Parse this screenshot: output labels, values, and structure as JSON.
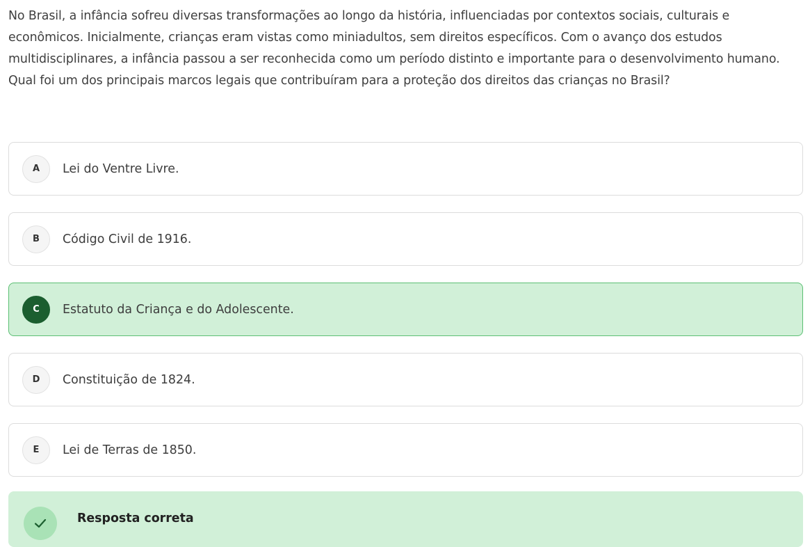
{
  "question": {
    "text": "No Brasil, a infância sofreu diversas transformações ao longo da história, influenciadas por contextos sociais, culturais e econômicos. Inicialmente, crianças eram vistas como miniadultos, sem direitos específicos. Com o avanço dos estudos multidisciplinares, a infância passou a ser reconhecida como um período distinto e importante para o desenvolvimento humano. Qual foi um dos principais marcos legais que contribuíram para a proteção dos direitos das crianças no Brasil?"
  },
  "options": [
    {
      "letter": "A",
      "text": "Lei do Ventre Livre."
    },
    {
      "letter": "B",
      "text": "Código Civil de 1916."
    },
    {
      "letter": "C",
      "text": "Estatuto da Criança e do Adolescente."
    },
    {
      "letter": "D",
      "text": "Constituição de 1824."
    },
    {
      "letter": "E",
      "text": "Lei de Terras de 1850."
    }
  ],
  "selected_option": "C",
  "feedback": {
    "title": "Resposta correta",
    "icon": "check-icon"
  },
  "colors": {
    "correct_bg": "#d1f0d8",
    "correct_border": "#5bbf73",
    "correct_badge": "#1b5e2f",
    "text": "#3d3d3d"
  }
}
